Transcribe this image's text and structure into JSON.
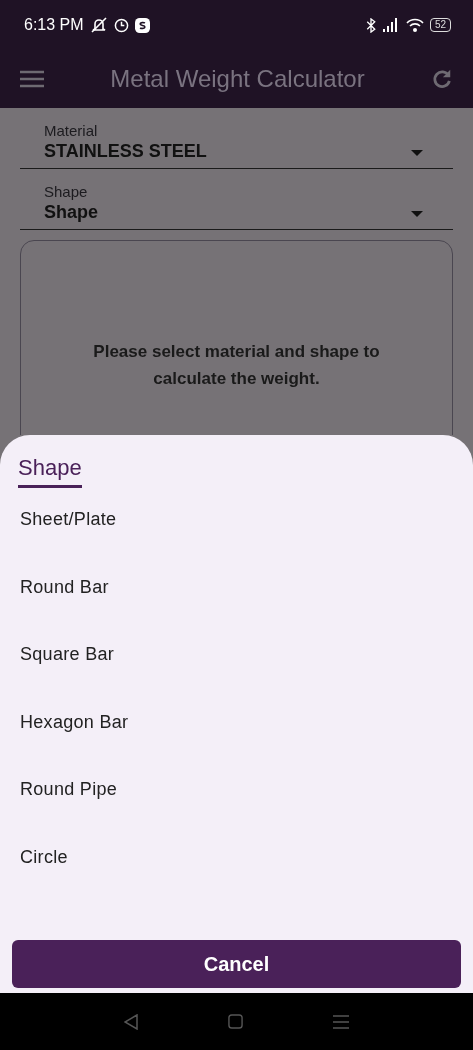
{
  "status_bar": {
    "time": "6:13 PM",
    "battery": "52"
  },
  "app_bar": {
    "title": "Metal Weight Calculator"
  },
  "form": {
    "fields": [
      {
        "label": "Material",
        "value": "STAINLESS STEEL"
      },
      {
        "label": "Shape",
        "value": "Shape"
      }
    ],
    "message": "Please select material and shape to calculate the weight."
  },
  "sheet": {
    "title": "Shape",
    "options": [
      "Sheet/Plate",
      "Round Bar",
      "Square Bar",
      "Hexagon Bar",
      "Round Pipe",
      "Circle"
    ],
    "cancel": "Cancel"
  }
}
